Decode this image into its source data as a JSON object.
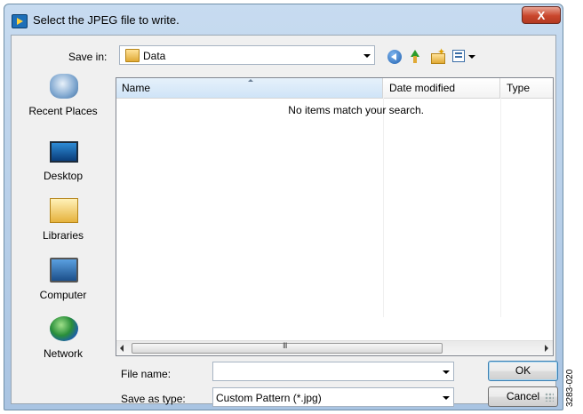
{
  "window": {
    "title": "Select the JPEG file to write.",
    "close_symbol": "X"
  },
  "toolbar": {
    "save_in_label": "Save in:",
    "save_in_value": "Data",
    "icons": [
      "back-icon",
      "up-folder-icon",
      "new-folder-icon",
      "views-menu-icon"
    ]
  },
  "places": [
    {
      "label": "Recent Places",
      "icon": "recent-places-icon"
    },
    {
      "label": "Desktop",
      "icon": "desktop-icon"
    },
    {
      "label": "Libraries",
      "icon": "libraries-icon"
    },
    {
      "label": "Computer",
      "icon": "computer-icon"
    },
    {
      "label": "Network",
      "icon": "network-icon"
    }
  ],
  "file_list": {
    "columns": [
      "Name",
      "Date modified",
      "Type"
    ],
    "empty_message": "No items match your search.",
    "scroll_grip": "III"
  },
  "form": {
    "file_name_label": "File name:",
    "file_name_value": "",
    "save_as_type_label": "Save as type:",
    "save_as_type_value": "Custom Pattern (*.jpg)"
  },
  "buttons": {
    "ok": "OK",
    "cancel": "Cancel"
  },
  "figure_id": "3283-020"
}
